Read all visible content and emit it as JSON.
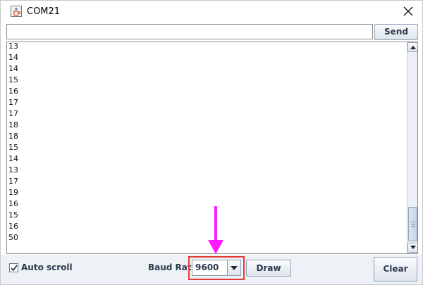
{
  "window": {
    "title": "COM21"
  },
  "send": {
    "input_value": "",
    "button_label": "Send"
  },
  "output": {
    "lines": [
      "13",
      "14",
      "14",
      "15",
      "16",
      "17",
      "17",
      "18",
      "18",
      "15",
      "14",
      "13",
      "17",
      "19",
      "16",
      "15",
      "16",
      "50"
    ]
  },
  "bottom": {
    "autoscroll_label": "Auto scroll",
    "autoscroll_checked": true,
    "baud_label": "Baud Rate",
    "baud_value": "9600",
    "draw_label": "Draw",
    "clear_label": "Clear"
  },
  "colors": {
    "highlight": "#e53935",
    "annotation_arrow": "#ff1aff"
  },
  "icons": {
    "app": "java-cup-icon",
    "close": "close-icon",
    "check": "check-icon",
    "dropdown": "triangle-down-icon"
  }
}
